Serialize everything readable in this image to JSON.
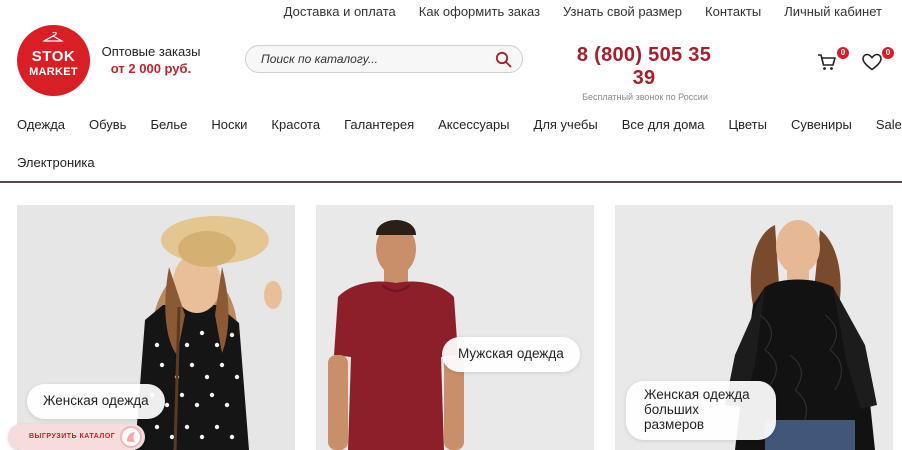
{
  "top_links": [
    "Доставка и оплата",
    "Как оформить заказ",
    "Узнать свой размер",
    "Контакты",
    "Личный кабинет"
  ],
  "logo": {
    "line1": "STOK",
    "line2": "MARKET"
  },
  "wholesale": {
    "line1": "Оптовые заказы",
    "line2": "от 2 000 руб."
  },
  "search": {
    "placeholder": "Поиск по каталогу..."
  },
  "phone": {
    "number": "8 (800) 505 35 39",
    "note": "Бесплатный звонок по России"
  },
  "cart": {
    "count": "0"
  },
  "favorites": {
    "count": "0"
  },
  "categories": [
    "Одежда",
    "Обувь",
    "Белье",
    "Носки",
    "Красота",
    "Галантерея",
    "Аксессуары",
    "Для учебы",
    "Все для дома",
    "Цветы",
    "Сувениры",
    "Sale",
    "Электроника"
  ],
  "cards": [
    {
      "label": "Женская одежда"
    },
    {
      "label": "Мужская одежда"
    },
    {
      "label_line1": "Женская одежда",
      "label_line2": "больших размеров"
    }
  ],
  "export_button": {
    "label": "ВЫГРУЗИТЬ КАТАЛОГ"
  },
  "colors": {
    "brand_red": "#d81f26",
    "phone_red": "#a3202c"
  }
}
